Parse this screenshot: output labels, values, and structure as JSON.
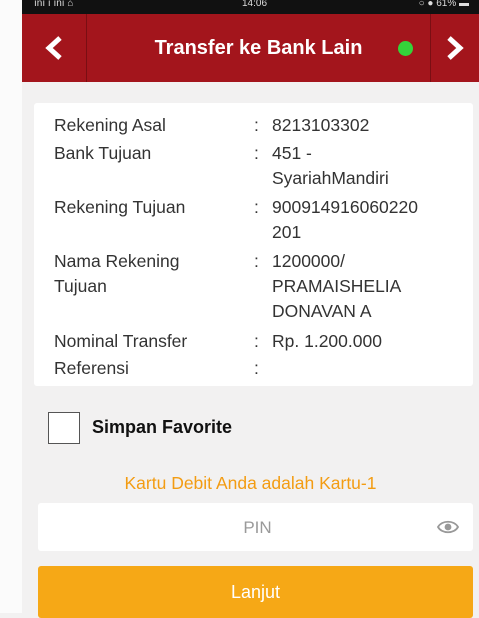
{
  "status_bar": {
    "left": "ını ı ını ⌂",
    "time": "14:06",
    "right": "○ ● 61% ▬"
  },
  "header": {
    "title": "Transfer ke Bank Lain",
    "back_icon": "chevron-left-icon",
    "forward_icon": "chevron-right-icon",
    "status_dot_color": "#34d33a",
    "bar_color": "#a3151c"
  },
  "details": {
    "rekening_asal": {
      "label": "Rekening Asal",
      "value": "8213103302"
    },
    "bank_tujuan": {
      "label": "Bank Tujuan",
      "value_line1": "451 -",
      "value_line2": "SyariahMandiri"
    },
    "rekening_tujuan": {
      "label": "Rekening Tujuan",
      "value_line1": "900914916060220",
      "value_line2": "201"
    },
    "nama_rekening": {
      "label_line1": "Nama Rekening",
      "label_line2": "Tujuan",
      "value_line1": "1200000/",
      "value_line2": "PRAMAISHELIA",
      "value_line3": "DONAVAN A"
    },
    "nominal": {
      "label": "Nominal Transfer",
      "value": "Rp. 1.200.000"
    },
    "referensi": {
      "label": "Referensi",
      "value": ""
    },
    "separator": ":"
  },
  "favorite": {
    "label": "Simpan Favorite",
    "checked": false
  },
  "debit_note": "Kartu Debit Anda adalah Kartu-1",
  "pin": {
    "placeholder": "PIN",
    "value": "",
    "icon": "eye-icon"
  },
  "submit": {
    "label": "Lanjut",
    "color": "#f6a816"
  }
}
